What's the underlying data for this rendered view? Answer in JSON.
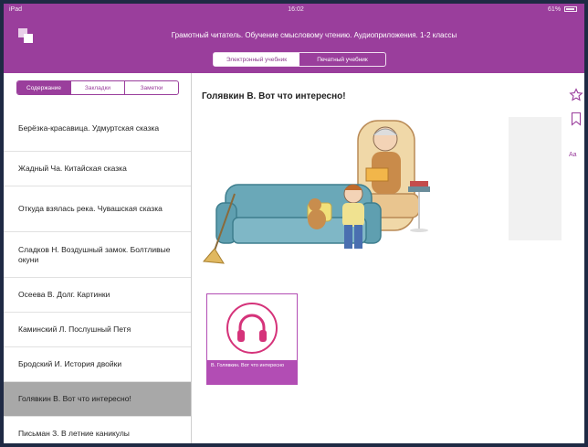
{
  "status": {
    "carrier": "iPad",
    "time": "16:02",
    "battery": "61%"
  },
  "header": {
    "title": "Грамотный читатель. Обучение смысловому чтению. Аудиоприложения. 1-2 классы",
    "segments": [
      "Электронный учебник",
      "Печатный учебник"
    ]
  },
  "sidebar": {
    "tabs": [
      "Содержание",
      "Закладки",
      "Заметки"
    ],
    "items": [
      {
        "label": "Берёзка-красавица. Удмуртская сказка"
      },
      {
        "label": "Жадный Ча. Китайская сказка"
      },
      {
        "label": "Откуда взялась река. Чувашская сказка"
      },
      {
        "label": "Сладков Н. Воздушный замок. Болтливые окуни"
      },
      {
        "label": "Осеева В. Долг. Картинки"
      },
      {
        "label": "Каминский Л. Послушный Петя"
      },
      {
        "label": "Бродский И. История двойки"
      },
      {
        "label": "Голявкин В. Вот что интересно!"
      },
      {
        "label": "Письман З. В летние каникулы"
      }
    ]
  },
  "main": {
    "title": "Голявкин В. Вот что интересно!",
    "media_card_label": "В. Голявкин. Вот что интересно",
    "font_button": "Aa"
  },
  "colors": {
    "accent": "#9a3e9c",
    "card": "#b24db4",
    "selected": "#a8a8a8"
  }
}
